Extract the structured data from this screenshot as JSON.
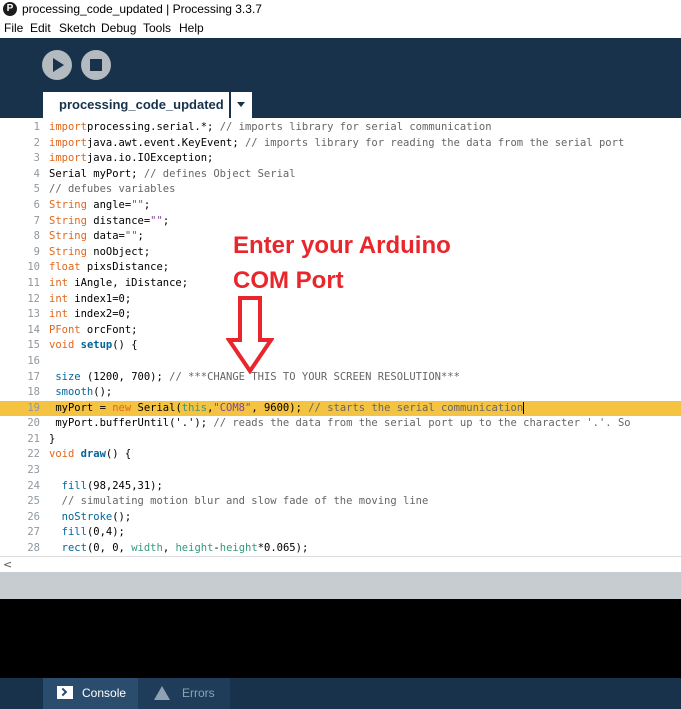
{
  "window": {
    "title": "processing_code_updated | Processing 3.3.7",
    "app_icon_glyph": "P"
  },
  "menu": [
    "File",
    "Edit",
    "Sketch",
    "Debug",
    "Tools",
    "Help"
  ],
  "toolbar": {
    "run_icon": "play-icon",
    "stop_icon": "stop-icon"
  },
  "tab": {
    "label": "processing_code_updated",
    "dropdown_icon": "chevron-down-icon"
  },
  "editor": {
    "highlight_line": 19,
    "lines": [
      {
        "n": "1",
        "parts": [
          [
            "k",
            "import"
          ],
          [
            "",
            "processing.serial.*; "
          ],
          [
            "c",
            "// imports library for serial communication"
          ]
        ]
      },
      {
        "n": "2",
        "parts": [
          [
            "k",
            "import"
          ],
          [
            "",
            "java.awt.event.KeyEvent; "
          ],
          [
            "c",
            "// imports library for reading the data from the serial port"
          ]
        ]
      },
      {
        "n": "3",
        "parts": [
          [
            "k",
            "import"
          ],
          [
            "",
            "java.io.IOException;"
          ]
        ]
      },
      {
        "n": "4",
        "parts": [
          [
            "",
            "Serial myPort; "
          ],
          [
            "c",
            "// defines Object Serial"
          ]
        ]
      },
      {
        "n": "5",
        "parts": [
          [
            "c",
            "// defubes variables"
          ]
        ]
      },
      {
        "n": "6",
        "parts": [
          [
            "k",
            "String"
          ],
          [
            "",
            " angle="
          ],
          [
            "s",
            "\"\""
          ],
          [
            "",
            ";"
          ]
        ]
      },
      {
        "n": "7",
        "parts": [
          [
            "k",
            "String"
          ],
          [
            "",
            " distance="
          ],
          [
            "s",
            "\"\""
          ],
          [
            "",
            ";"
          ]
        ]
      },
      {
        "n": "8",
        "parts": [
          [
            "k",
            "String"
          ],
          [
            "",
            " data="
          ],
          [
            "s",
            "\"\""
          ],
          [
            "",
            ";"
          ]
        ]
      },
      {
        "n": "9",
        "parts": [
          [
            "k",
            "String"
          ],
          [
            "",
            " noObject;"
          ]
        ]
      },
      {
        "n": "10",
        "parts": [
          [
            "k",
            "float"
          ],
          [
            "",
            " pixsDistance;"
          ]
        ]
      },
      {
        "n": "11",
        "parts": [
          [
            "k",
            "int"
          ],
          [
            "",
            " iAngle, iDistance;"
          ]
        ]
      },
      {
        "n": "12",
        "parts": [
          [
            "k",
            "int"
          ],
          [
            "",
            " index1=0;"
          ]
        ]
      },
      {
        "n": "13",
        "parts": [
          [
            "k",
            "int"
          ],
          [
            "",
            " index2=0;"
          ]
        ]
      },
      {
        "n": "14",
        "parts": [
          [
            "k",
            "PFont"
          ],
          [
            "",
            " orcFont;"
          ]
        ]
      },
      {
        "n": "15",
        "parts": [
          [
            "k",
            "void"
          ],
          [
            "",
            " "
          ],
          [
            "fb",
            "setup"
          ],
          [
            "",
            "() {"
          ]
        ]
      },
      {
        "n": "16",
        "parts": []
      },
      {
        "n": "17",
        "parts": [
          [
            "",
            " "
          ],
          [
            "f",
            "size"
          ],
          [
            "",
            " (1200, 700); "
          ],
          [
            "c",
            "// ***CHANGE THIS TO YOUR SCREEN RESOLUTION***"
          ]
        ]
      },
      {
        "n": "18",
        "parts": [
          [
            "",
            " "
          ],
          [
            "f",
            "smooth"
          ],
          [
            "",
            "();"
          ]
        ]
      },
      {
        "n": "19",
        "parts": [
          [
            "",
            " myPort = "
          ],
          [
            "k",
            "new"
          ],
          [
            "",
            " Serial("
          ],
          [
            "t",
            "this"
          ],
          [
            "",
            ","
          ],
          [
            "s",
            "\"COM8\""
          ],
          [
            "",
            ", 9600); "
          ],
          [
            "c",
            "// starts the serial communication"
          ]
        ]
      },
      {
        "n": "20",
        "parts": [
          [
            "",
            " myPort.bufferUntil('.'); "
          ],
          [
            "c",
            "// reads the data from the serial port up to the character '.'. So"
          ]
        ]
      },
      {
        "n": "21",
        "parts": [
          [
            "",
            "}"
          ]
        ]
      },
      {
        "n": "22",
        "parts": [
          [
            "k",
            "void"
          ],
          [
            "",
            " "
          ],
          [
            "fb",
            "draw"
          ],
          [
            "",
            "() {"
          ]
        ]
      },
      {
        "n": "23",
        "parts": []
      },
      {
        "n": "24",
        "parts": [
          [
            "",
            "  "
          ],
          [
            "f",
            "fill"
          ],
          [
            "",
            "(98,245,31);"
          ]
        ]
      },
      {
        "n": "25",
        "parts": [
          [
            "",
            "  "
          ],
          [
            "c",
            "// simulating motion blur and slow fade of the moving line"
          ]
        ]
      },
      {
        "n": "26",
        "parts": [
          [
            "",
            "  "
          ],
          [
            "f",
            "noStroke"
          ],
          [
            "",
            "();"
          ]
        ]
      },
      {
        "n": "27",
        "parts": [
          [
            "",
            "  "
          ],
          [
            "f",
            "fill"
          ],
          [
            "",
            "(0,4);"
          ]
        ]
      },
      {
        "n": "28",
        "parts": [
          [
            "",
            "  "
          ],
          [
            "f",
            "rect"
          ],
          [
            "",
            "(0, 0, "
          ],
          [
            "t",
            "width"
          ],
          [
            "",
            ", "
          ],
          [
            "t",
            "height"
          ],
          [
            "",
            "-"
          ],
          [
            "t",
            "height"
          ],
          [
            "",
            "*0.065);"
          ]
        ]
      }
    ]
  },
  "annotation": {
    "line1": "Enter your Arduino",
    "line2": "COM Port",
    "color": "#e8262b"
  },
  "scrollbar": {
    "left_arrow": "<"
  },
  "console_tabs": [
    {
      "label": "Console",
      "icon": "console-icon"
    },
    {
      "label": "Errors",
      "icon": "warning-icon"
    }
  ],
  "colors": {
    "toolbar_bg": "#17324a",
    "highlight": "#f5c342",
    "keyword": "#e2661a",
    "comment": "#666666"
  }
}
